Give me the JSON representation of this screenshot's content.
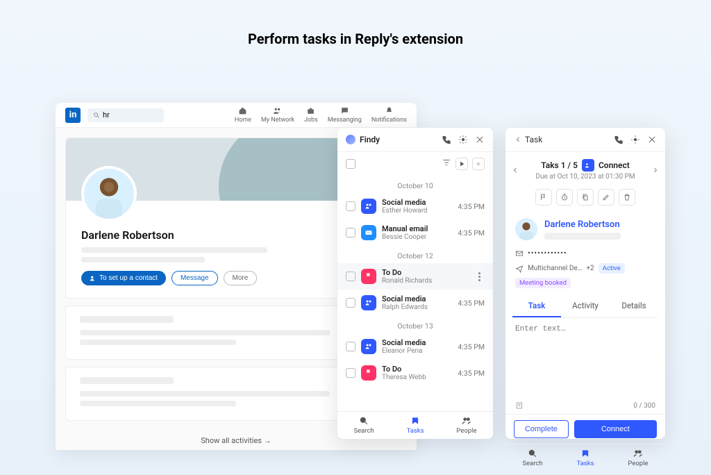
{
  "page_title": "Perform tasks in Reply's extension",
  "linkedin": {
    "logo": "in",
    "search_value": "hr",
    "nav": [
      "Home",
      "My Network",
      "Jobs",
      "Messanging",
      "Notifications"
    ],
    "profile_name": "Darlene Robertson",
    "primary_btn": "To set up a contact",
    "message_btn": "Message",
    "more_btn": "More",
    "show_all": "Show all activities →"
  },
  "findy": {
    "title": "Findy",
    "groups": [
      {
        "date": "October 10",
        "items": [
          {
            "type": "Social media",
            "name": "Esther Howard",
            "time": "4:35 PM",
            "icon": "blue"
          },
          {
            "type": "Manual email",
            "name": "Bessie Cooper",
            "time": "4:35 PM",
            "icon": "email"
          }
        ]
      },
      {
        "date": "October 12",
        "items": [
          {
            "type": "To Do",
            "name": "Ronald Richards",
            "time": "",
            "icon": "red",
            "selected": true
          },
          {
            "type": "Social media",
            "name": "Ralph Edwards",
            "time": "4:35 PM",
            "icon": "blue"
          }
        ]
      },
      {
        "date": "October 13",
        "items": [
          {
            "type": "Social media",
            "name": "Eleanor Pena",
            "time": "4:35 PM",
            "icon": "blue"
          },
          {
            "type": "To Do",
            "name": "Theresa Webb",
            "time": "4:35 PM",
            "icon": "red"
          }
        ]
      }
    ],
    "tabs": [
      "Search",
      "Tasks",
      "People"
    ],
    "active_tab": "Tasks"
  },
  "task": {
    "back": "Task",
    "counter": "Taks 1 / 5",
    "action": "Connect",
    "due": "Due at Oct 10, 2023 at 01:30 PM",
    "person_name": "Darlene Robertson",
    "email_masked": "••••••••••••",
    "sequence": "Multichannel De…",
    "extra": "+2",
    "tag_active": "Active",
    "tag_meeting": "Meeting booked",
    "tabs": [
      "Task",
      "Activity",
      "Details"
    ],
    "active_tab": "Task",
    "placeholder": "Enter text…",
    "count": "0 / 300",
    "complete_btn": "Complete",
    "connect_btn": "Connect",
    "bottom_tabs": [
      "Search",
      "Tasks",
      "People"
    ],
    "bottom_active": "Tasks"
  }
}
